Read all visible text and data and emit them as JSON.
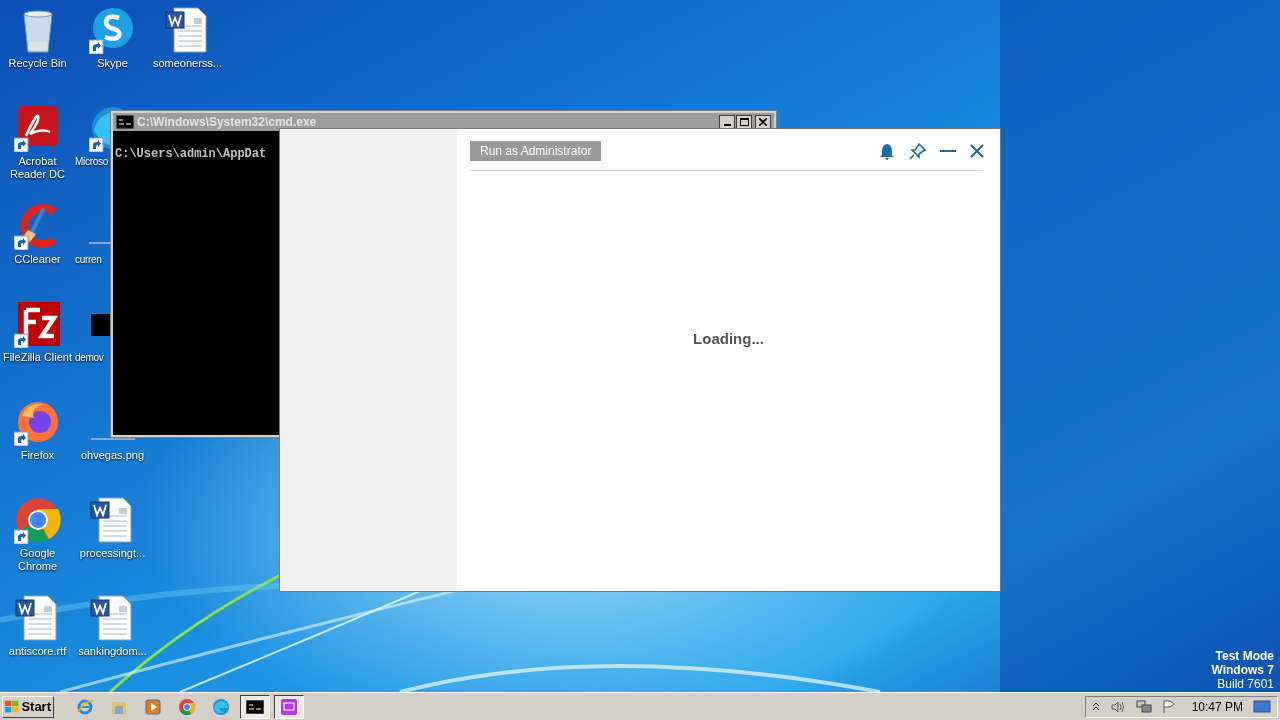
{
  "desktop_icons": [
    {
      "label": "Recycle Bin",
      "kind": "recycle",
      "shortcut": false,
      "covered": false
    },
    {
      "label": "Acrobat Reader DC",
      "kind": "acrobat",
      "shortcut": true,
      "covered": false
    },
    {
      "label": "CCleaner",
      "kind": "ccleaner",
      "shortcut": true,
      "covered": false
    },
    {
      "label": "FileZilla Client",
      "kind": "filezilla",
      "shortcut": true,
      "covered": false
    },
    {
      "label": "Firefox",
      "kind": "firefox",
      "shortcut": true,
      "covered": false
    },
    {
      "label": "Google Chrome",
      "kind": "chrome",
      "shortcut": true,
      "covered": false
    },
    {
      "label": "antiscore.rtf",
      "kind": "word",
      "shortcut": false,
      "covered": false
    },
    {
      "label": "Skype",
      "kind": "skype",
      "shortcut": true,
      "covered": false
    },
    {
      "label": "Microso",
      "kind": "edge",
      "shortcut": true,
      "covered": true
    },
    {
      "label": "curren",
      "kind": "blank",
      "shortcut": false,
      "covered": true
    },
    {
      "label": "demov",
      "kind": "black",
      "shortcut": false,
      "covered": true
    },
    {
      "label": "ohvegas.png",
      "kind": "blank",
      "shortcut": false,
      "covered": false
    },
    {
      "label": "processingt...",
      "kind": "word",
      "shortcut": false,
      "covered": false
    },
    {
      "label": "sankingdom...",
      "kind": "word",
      "shortcut": false,
      "covered": false
    },
    {
      "label": "someonerss...",
      "kind": "word",
      "shortcut": false,
      "covered": false
    }
  ],
  "cmd_window": {
    "title": "C:\\Windows\\System32\\cmd.exe",
    "lines": [
      "C:\\Users\\admin\\AppDat"
    ]
  },
  "app_window": {
    "button": "Run as Administrator",
    "status": "Loading..."
  },
  "system_info": [
    {
      "text": "Test Mode",
      "bold": true
    },
    {
      "text": "Windows 7",
      "bold": true
    },
    {
      "text": "Build 7601",
      "bold": false
    }
  ],
  "taskbar": {
    "start": "Start",
    "items": [
      {
        "kind": "ie",
        "selected": false
      },
      {
        "kind": "explorer",
        "selected": false
      },
      {
        "kind": "media",
        "selected": false
      },
      {
        "kind": "chrome",
        "selected": false
      },
      {
        "kind": "edge",
        "selected": false
      },
      {
        "kind": "cmd",
        "selected": true
      },
      {
        "kind": "purple",
        "selected": true
      }
    ],
    "clock": "10:47 PM"
  }
}
